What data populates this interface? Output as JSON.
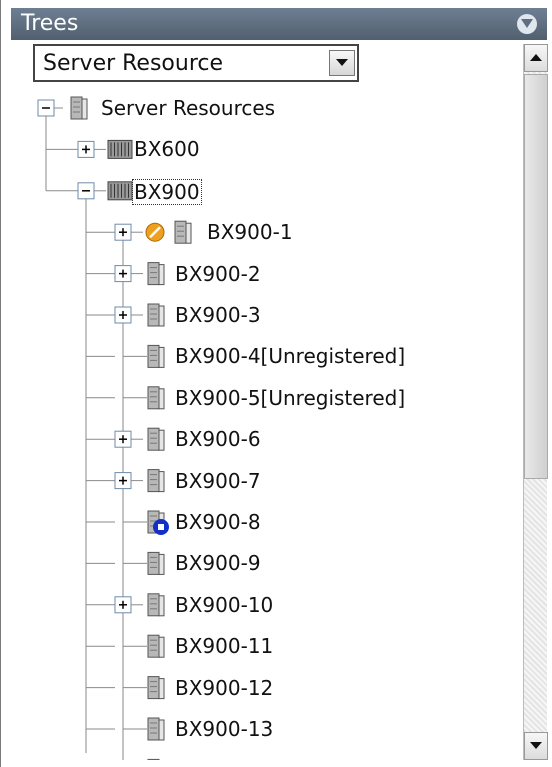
{
  "panel": {
    "title": "Trees"
  },
  "resource_select": {
    "value": "Server Resource"
  },
  "tree": {
    "root": "Server Resources",
    "chassis": [
      {
        "label": "BX600",
        "expanded": false
      },
      {
        "label": "BX900",
        "expanded": true,
        "focused": true
      }
    ],
    "servers": [
      {
        "label": "BX900-1",
        "expandable": true,
        "status": "stop"
      },
      {
        "label": "BX900-2",
        "expandable": true
      },
      {
        "label": "BX900-3",
        "expandable": true
      },
      {
        "label": "BX900-4[Unregistered]",
        "expandable": false
      },
      {
        "label": "BX900-5[Unregistered]",
        "expandable": false
      },
      {
        "label": "BX900-6",
        "expandable": true
      },
      {
        "label": "BX900-7",
        "expandable": true
      },
      {
        "label": "BX900-8",
        "expandable": false,
        "status": "maintenance"
      },
      {
        "label": "BX900-9",
        "expandable": false
      },
      {
        "label": "BX900-10",
        "expandable": true
      },
      {
        "label": "BX900-11",
        "expandable": false
      },
      {
        "label": "BX900-12",
        "expandable": false
      },
      {
        "label": "BX900-13",
        "expandable": false
      }
    ]
  },
  "colors": {
    "titlebar": "#5f6f82",
    "tree_line": "#8a8a8a",
    "status_stop": "#f0a020",
    "status_maintenance": "#1030c8"
  }
}
